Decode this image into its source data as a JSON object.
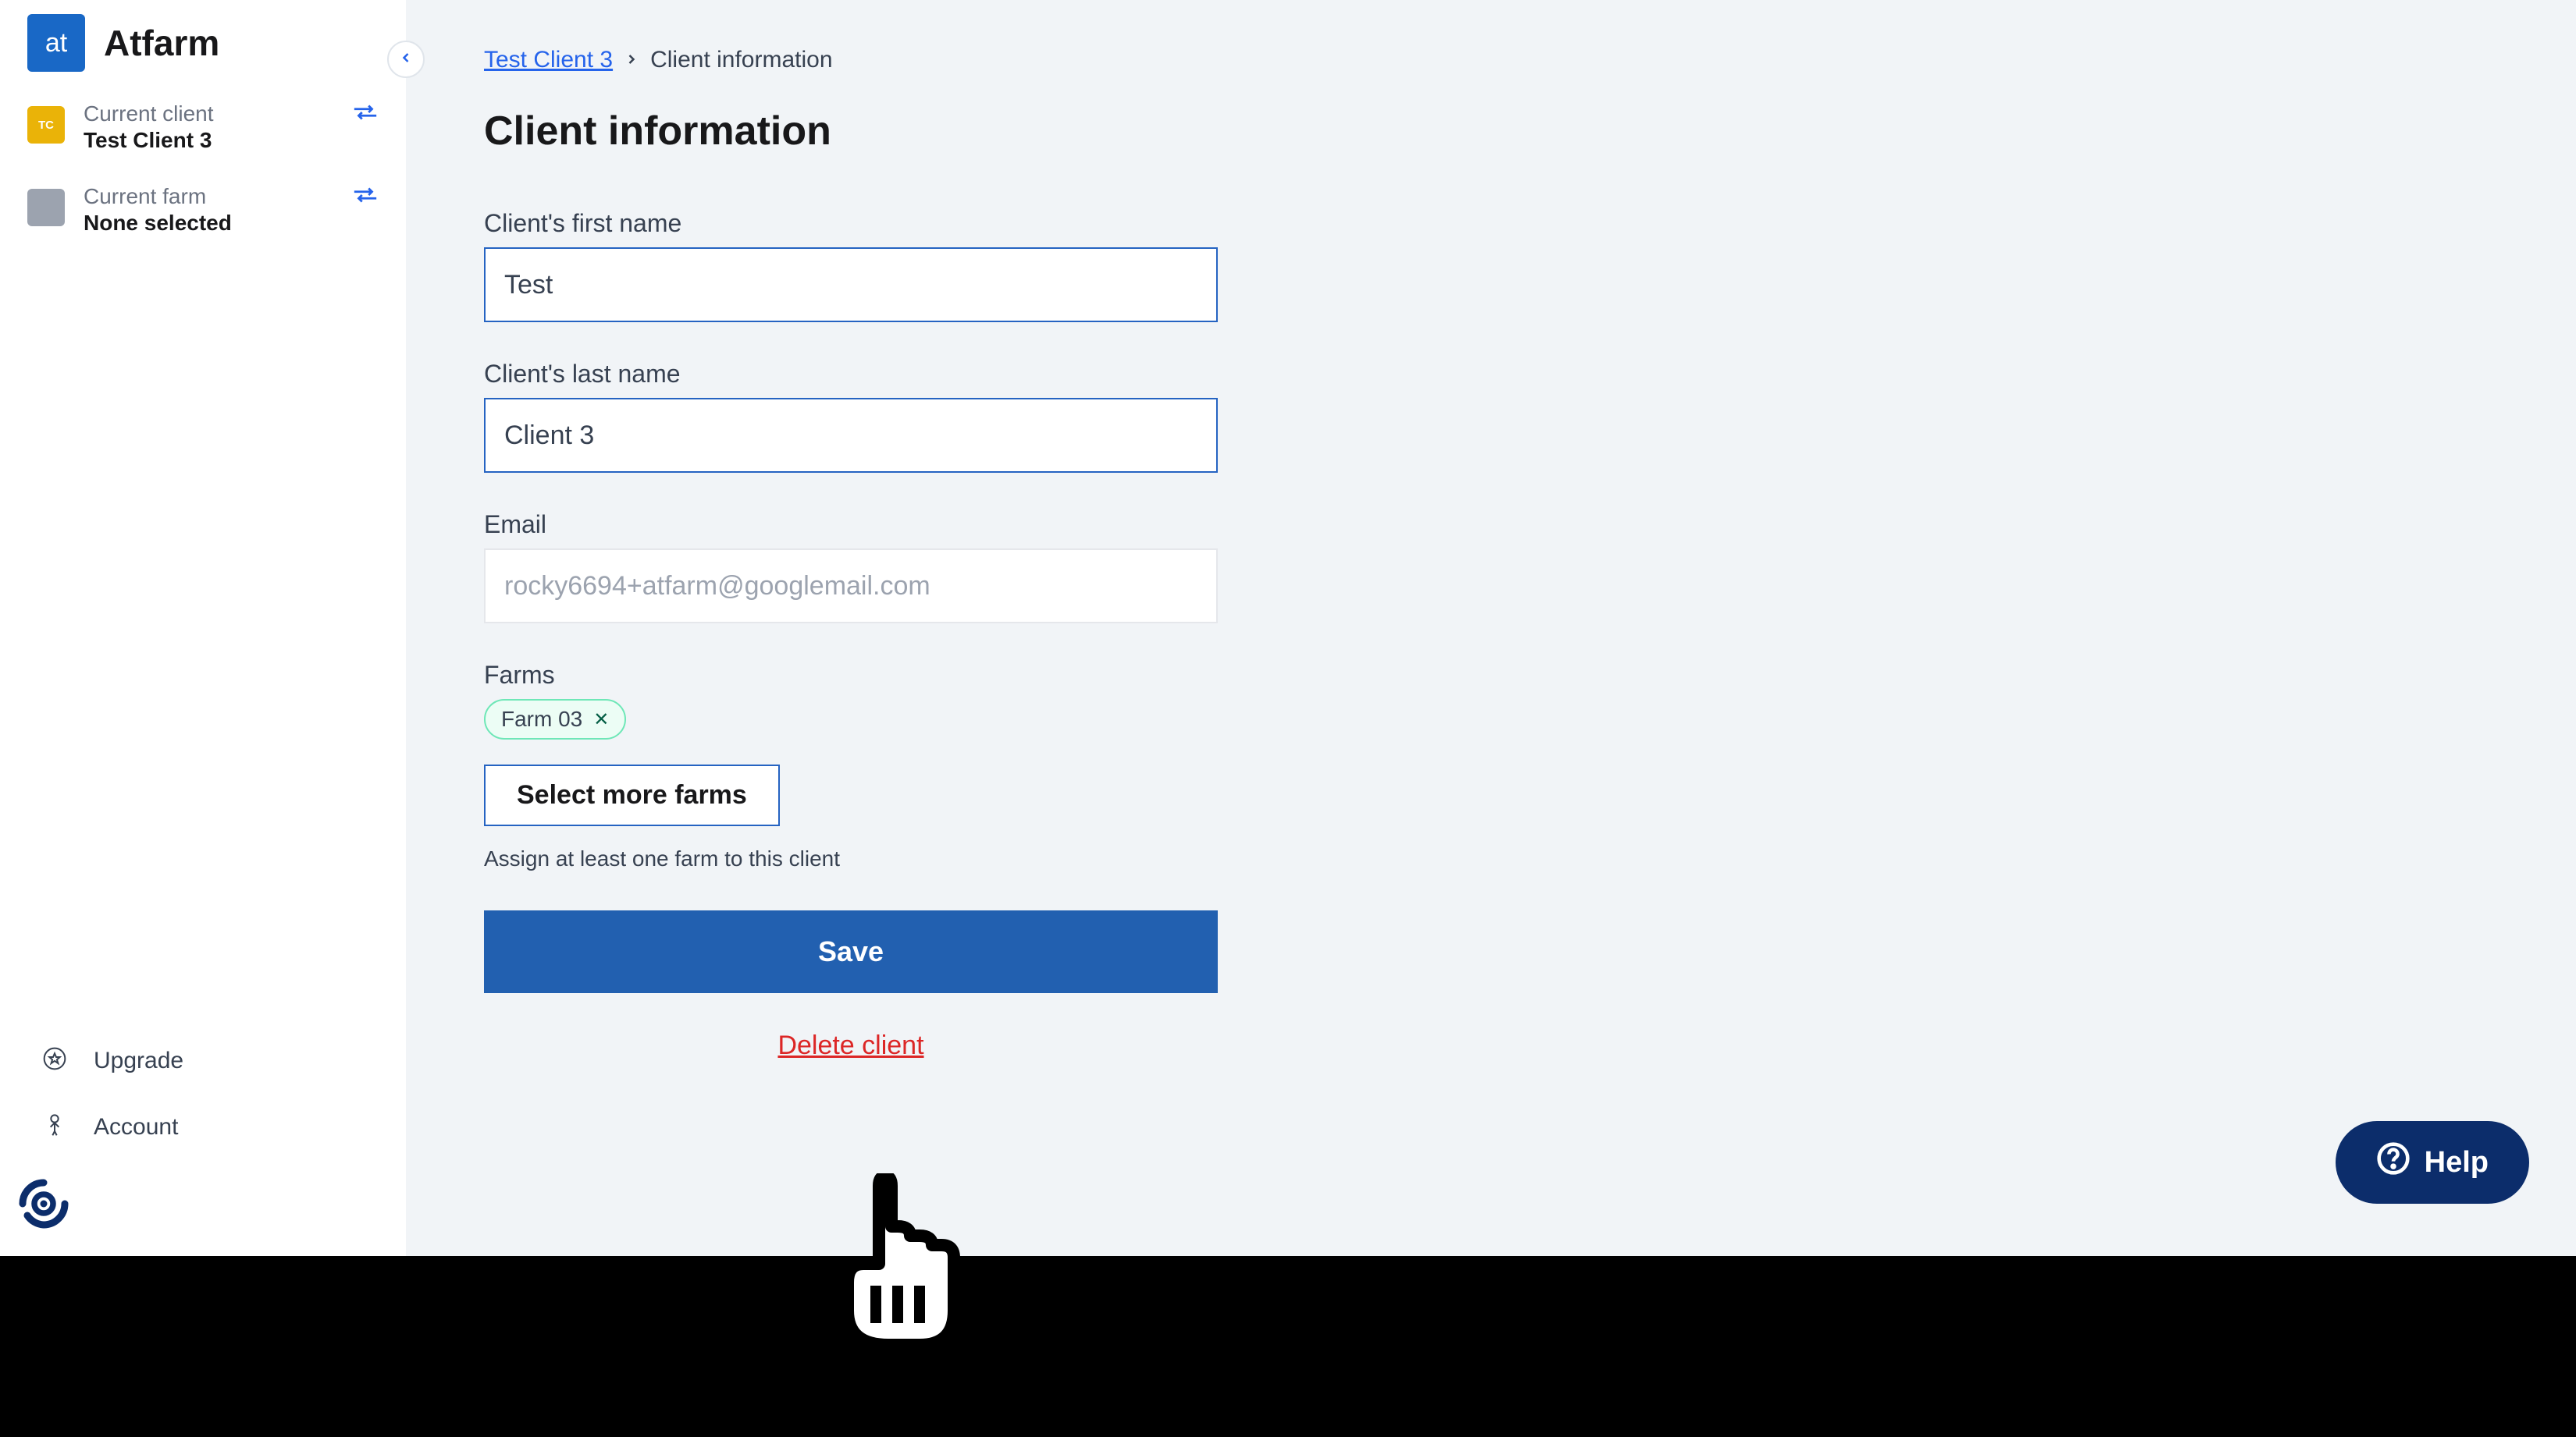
{
  "app": {
    "logo_text": "at",
    "name": "Atfarm"
  },
  "sidebar": {
    "client": {
      "label": "Current client",
      "value": "Test Client 3",
      "avatar_text": "TC"
    },
    "farm": {
      "label": "Current farm",
      "value": "None selected"
    },
    "upgrade_label": "Upgrade",
    "account_label": "Account"
  },
  "breadcrumb": {
    "link_label": "Test Client 3",
    "current_label": "Client information"
  },
  "page": {
    "title": "Client information"
  },
  "form": {
    "first_name_label": "Client's first name",
    "first_name_value": "Test",
    "last_name_label": "Client's last name",
    "last_name_value": "Client 3",
    "email_label": "Email",
    "email_value": "rocky6694+atfarm@googlemail.com",
    "farms_label": "Farms",
    "farm_tags": [
      "Farm 03"
    ],
    "select_farms_label": "Select more farms",
    "farms_hint": "Assign at least one farm to this client",
    "save_label": "Save",
    "delete_label": "Delete client"
  },
  "help": {
    "label": "Help"
  }
}
